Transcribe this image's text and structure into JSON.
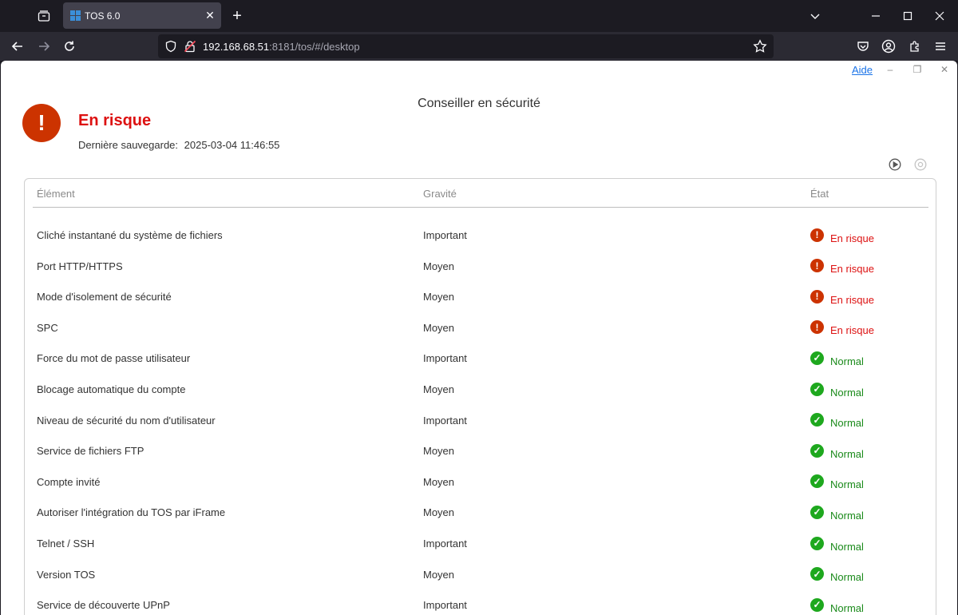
{
  "browser": {
    "tab_title": "TOS 6.0",
    "tab_close": "✕",
    "new_tab": "+",
    "url_host": "192.168.68.51",
    "url_rest": ":8181/tos/#/desktop"
  },
  "app": {
    "title": "Conseiller en sécurité",
    "help": "Aide",
    "minimize": "–",
    "restore": "❐",
    "close": "✕",
    "risk_icon": "!",
    "status_title": "En risque",
    "last_save_label": "Dernière sauvegarde:",
    "last_save_value": "2025-03-04 11:46:55",
    "colors": {
      "risk": "#cc3300",
      "risk_text": "#dd1111",
      "normal": "#1ea81e",
      "normal_text": "#1a8a1a"
    }
  },
  "table": {
    "headers": {
      "element": "Élément",
      "severity": "Gravité",
      "state": "État"
    },
    "rows": [
      {
        "element": "Cliché instantané du système de fichiers",
        "severity": "Important",
        "state": "En risque",
        "status": "risk"
      },
      {
        "element": "Port HTTP/HTTPS",
        "severity": "Moyen",
        "state": "En risque",
        "status": "risk"
      },
      {
        "element": "Mode d'isolement de sécurité",
        "severity": "Moyen",
        "state": "En risque",
        "status": "risk"
      },
      {
        "element": "SPC",
        "severity": "Moyen",
        "state": "En risque",
        "status": "risk"
      },
      {
        "element": "Force du mot de passe utilisateur",
        "severity": "Important",
        "state": "Normal",
        "status": "normal"
      },
      {
        "element": "Blocage automatique du compte",
        "severity": "Moyen",
        "state": "Normal",
        "status": "normal"
      },
      {
        "element": "Niveau de sécurité du nom d'utilisateur",
        "severity": "Important",
        "state": "Normal",
        "status": "normal"
      },
      {
        "element": "Service de fichiers FTP",
        "severity": "Moyen",
        "state": "Normal",
        "status": "normal"
      },
      {
        "element": "Compte invité",
        "severity": "Moyen",
        "state": "Normal",
        "status": "normal"
      },
      {
        "element": "Autoriser l'intégration du TOS par iFrame",
        "severity": "Moyen",
        "state": "Normal",
        "status": "normal"
      },
      {
        "element": "Telnet / SSH",
        "severity": "Important",
        "state": "Normal",
        "status": "normal"
      },
      {
        "element": "Version TOS",
        "severity": "Moyen",
        "state": "Normal",
        "status": "normal"
      },
      {
        "element": "Service de découverte UPnP",
        "severity": "Important",
        "state": "Normal",
        "status": "normal"
      }
    ]
  }
}
